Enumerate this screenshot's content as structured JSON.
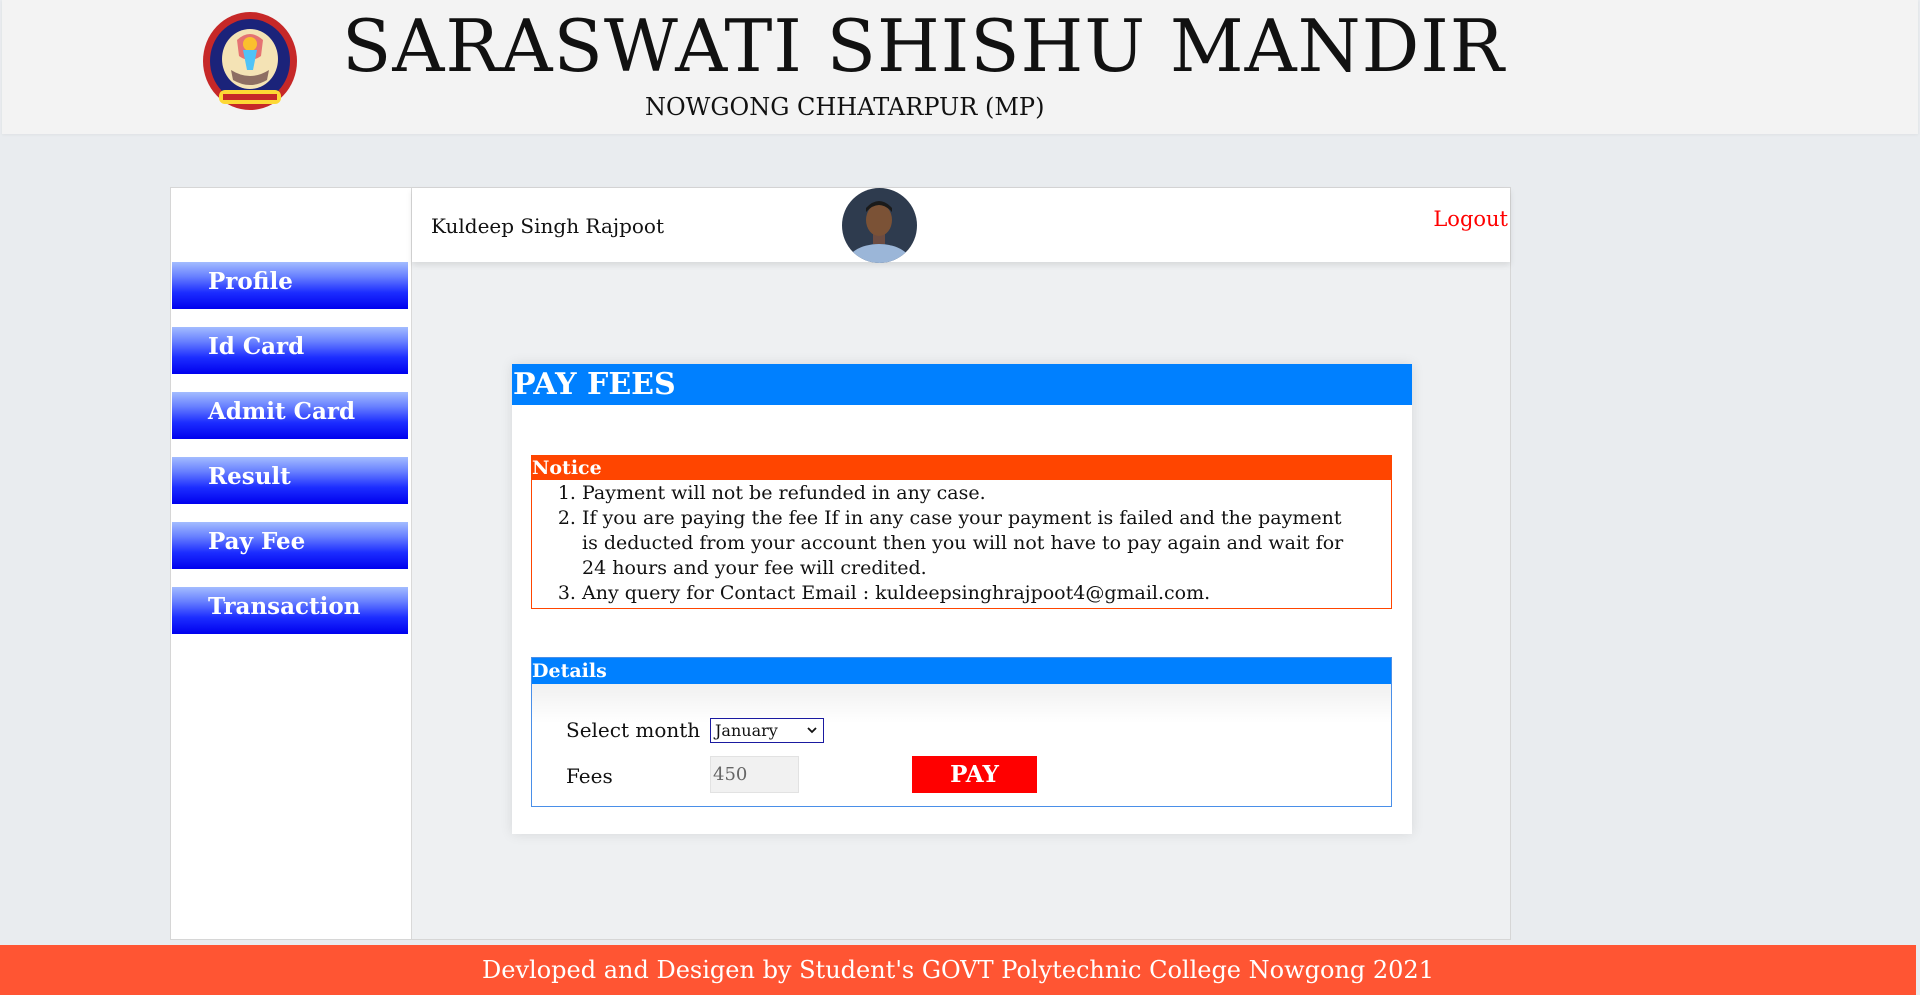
{
  "header": {
    "title": "SARASWATI SHISHU MANDIR",
    "subtitle": "NOWGONG CHHATARPUR (MP)",
    "logo_icon": "school-emblem-icon"
  },
  "sidebar": {
    "items": [
      {
        "label": "Profile"
      },
      {
        "label": "Id Card"
      },
      {
        "label": "Admit Card"
      },
      {
        "label": "Result"
      },
      {
        "label": "Pay Fee"
      },
      {
        "label": "Transaction"
      }
    ]
  },
  "topbar": {
    "user_name": "Kuldeep Singh Rajpoot",
    "avatar_icon": "user-avatar-icon",
    "logout_label": "Logout"
  },
  "pay_fees": {
    "title": "PAY FEES",
    "notice": {
      "heading": "Notice",
      "items": [
        "Payment will not be refunded in any case.",
        "If you are paying the fee If in any case your payment is failed and the payment is deducted from your account then you will not have to pay again and wait for 24 hours and your fee will credited.",
        "Any query for Contact Email : kuldeepsinghrajpoot4@gmail.com."
      ]
    },
    "details": {
      "heading": "Details",
      "month_label": "Select month",
      "month_value": "January",
      "fees_label": "Fees",
      "fees_value": "450",
      "pay_label": "PAY"
    }
  },
  "footer": {
    "text": "Devloped and Desigen by Student's GOVT Polytechnic College Nowgong 2021"
  },
  "colors": {
    "sidebar_button": "#0000ee",
    "card_header": "#0080ff",
    "notice_header": "#ff4500",
    "pay_button": "#ff0000",
    "logout": "#ff0000",
    "footer": "#ff5533"
  }
}
